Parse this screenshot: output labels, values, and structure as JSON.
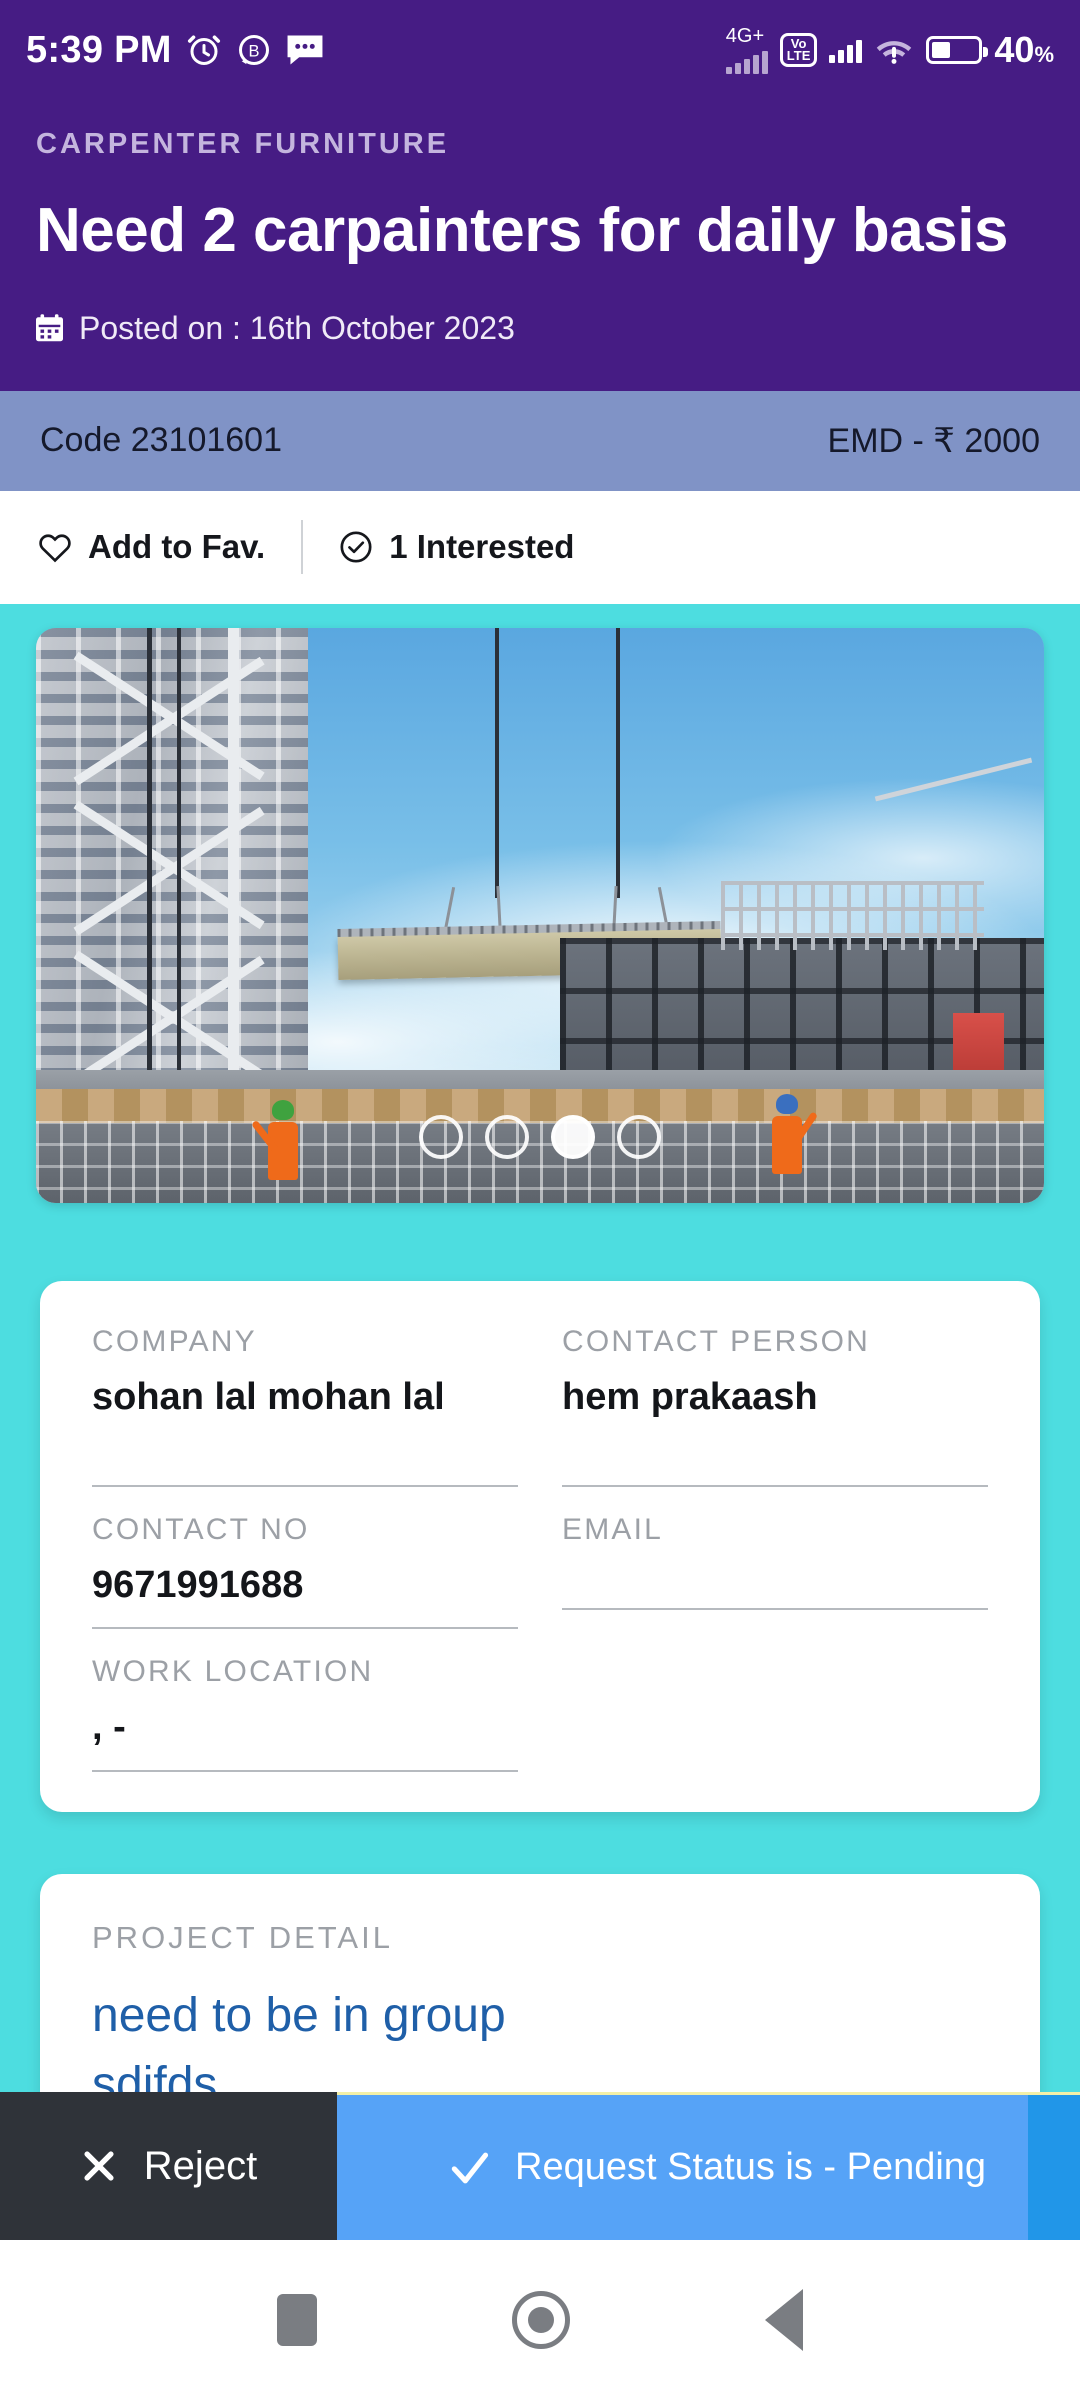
{
  "status_bar": {
    "time": "5:39 PM",
    "icons": [
      "alarm-icon",
      "bluetooth-b-icon",
      "message-icon"
    ],
    "network_label": "4G+",
    "volte_top": "Vo",
    "volte_bottom": "LTE",
    "battery_percent": "40",
    "battery_percent_symbol": "%",
    "background_color": "#461C84"
  },
  "header": {
    "category": "CARPENTER FURNITURE",
    "title": "Need 2 carpainters for daily basis",
    "posted_icon": "calendar-icon",
    "posted_on": "Posted on : 16th October 2023"
  },
  "code_bar": {
    "code": "Code 23101601",
    "emd": "EMD - ₹ 2000",
    "background_color": "#8093C6"
  },
  "fav_bar": {
    "favourite_icon": "heart-icon",
    "favourite_label": "Add to Fav.",
    "interested_icon": "check-circle-icon",
    "interested_label": "1 Interested"
  },
  "carousel": {
    "image_alt": "construction-site-crane-lifting-concrete-slab",
    "total_dots": 4,
    "active_index": 2
  },
  "info_card": {
    "fields": [
      {
        "label": "COMPANY",
        "value": "sohan lal mohan lal"
      },
      {
        "label": "CONTACT PERSON",
        "value": "hem prakaash"
      },
      {
        "label": "CONTACT NO",
        "value": "9671991688"
      },
      {
        "label": "EMAIL",
        "value": ""
      },
      {
        "label": "WORK LOCATION",
        "value": ", -"
      }
    ]
  },
  "project_card": {
    "label": "PROJECT DETAIL",
    "body_line1": "need to be in group",
    "body_line2": "sdifds"
  },
  "action_bar": {
    "reject_icon": "close-x-icon",
    "reject_label": "Reject",
    "status_icon": "check-icon",
    "status_label": "Request Status is - Pending",
    "reject_color": "#2F3339",
    "status_color": "#56A3F7"
  },
  "nav_bar": {
    "recents_icon": "square-icon",
    "home_icon": "circle-icon",
    "back_icon": "triangle-back-icon"
  },
  "theme": {
    "purple": "#461C84",
    "turquoise": "#4DDDE0",
    "link_blue": "#1f5fa8"
  }
}
